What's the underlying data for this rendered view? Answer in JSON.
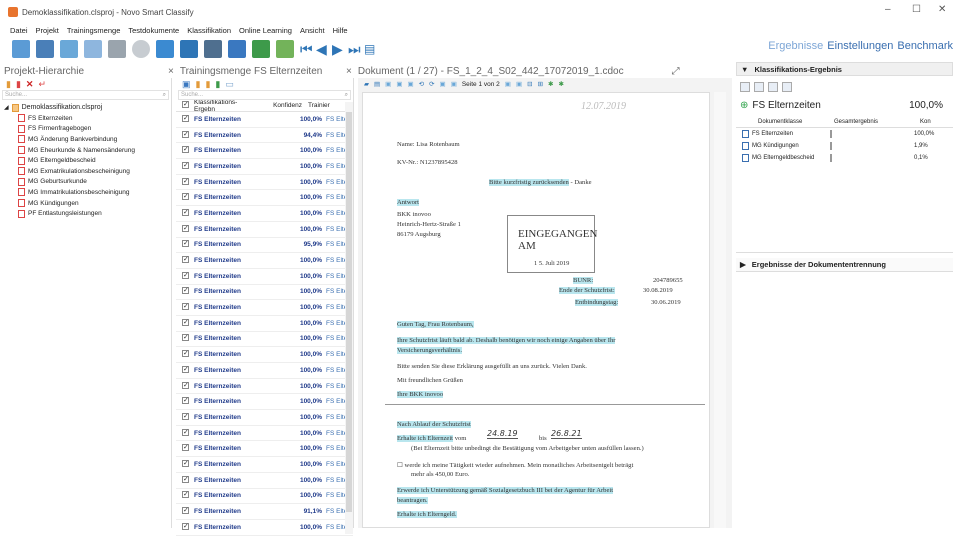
{
  "window": {
    "title": "Demoklassifikation.clsproj - Novo Smart Classify",
    "controls": [
      "–",
      "☐",
      "✕"
    ]
  },
  "menu": [
    "Datei",
    "Projekt",
    "Trainingsmenge",
    "Testdokumente",
    "Klassifikation",
    "Online Learning",
    "Ansicht",
    "Hilfe"
  ],
  "topnav": [
    "Ergebnisse",
    "Einstellungen",
    "Benchmark"
  ],
  "panels": {
    "left_title": "Projekt-Hierarchie",
    "mid_title": "Trainingsmenge FS Elternzeiten",
    "doc_title": "Dokument (1 / 27) - FS_1_2_4_S02_442_17072019_1.cdoc"
  },
  "tree": {
    "search_placeholder": "Suche...",
    "root": "Demoklassifikation.clsproj",
    "items": [
      "FS Elternzeiten",
      "FS Firmenfragebogen",
      "MG Änderung Bankverbindung",
      "MG Eheurkunde & Namensänderung",
      "MG Elterngeldbescheid",
      "MG Exmatrikulationsbescheinigung",
      "MG Geburtsurkunde",
      "MG Immatrikulationsbescheinigung",
      "MG Kündigungen",
      "PF Entlastungsleistungen"
    ]
  },
  "training": {
    "search_placeholder": "Suche...",
    "columns": [
      "Klassifikations-Ergebn",
      "Konfidenz",
      "Trainier"
    ],
    "rows": [
      {
        "label": "FS Elternzeiten",
        "conf": "100,0%",
        "train": "FS Elte"
      },
      {
        "label": "FS Elternzeiten",
        "conf": "94,4%",
        "train": "FS Elte"
      },
      {
        "label": "FS Elternzeiten",
        "conf": "100,0%",
        "train": "FS Elte"
      },
      {
        "label": "FS Elternzeiten",
        "conf": "100,0%",
        "train": "FS Elte"
      },
      {
        "label": "FS Elternzeiten",
        "conf": "100,0%",
        "train": "FS Elte"
      },
      {
        "label": "FS Elternzeiten",
        "conf": "100,0%",
        "train": "FS Elte"
      },
      {
        "label": "FS Elternzeiten",
        "conf": "100,0%",
        "train": "FS Elte"
      },
      {
        "label": "FS Elternzeiten",
        "conf": "100,0%",
        "train": "FS Elte"
      },
      {
        "label": "FS Elternzeiten",
        "conf": "95,9%",
        "train": "FS Elte"
      },
      {
        "label": "FS Elternzeiten",
        "conf": "100,0%",
        "train": "FS Elte"
      },
      {
        "label": "FS Elternzeiten",
        "conf": "100,0%",
        "train": "FS Elte"
      },
      {
        "label": "FS Elternzeiten",
        "conf": "100,0%",
        "train": "FS Elte"
      },
      {
        "label": "FS Elternzeiten",
        "conf": "100,0%",
        "train": "FS Elte"
      },
      {
        "label": "FS Elternzeiten",
        "conf": "100,0%",
        "train": "FS Elte"
      },
      {
        "label": "FS Elternzeiten",
        "conf": "100,0%",
        "train": "FS Elte"
      },
      {
        "label": "FS Elternzeiten",
        "conf": "100,0%",
        "train": "FS Elte"
      },
      {
        "label": "FS Elternzeiten",
        "conf": "100,0%",
        "train": "FS Elte"
      },
      {
        "label": "FS Elternzeiten",
        "conf": "100,0%",
        "train": "FS Elte"
      },
      {
        "label": "FS Elternzeiten",
        "conf": "100,0%",
        "train": "FS Elte"
      },
      {
        "label": "FS Elternzeiten",
        "conf": "100,0%",
        "train": "FS Elte"
      },
      {
        "label": "FS Elternzeiten",
        "conf": "100,0%",
        "train": "FS Elte"
      },
      {
        "label": "FS Elternzeiten",
        "conf": "100,0%",
        "train": "FS Elte"
      },
      {
        "label": "FS Elternzeiten",
        "conf": "100,0%",
        "train": "FS Elte"
      },
      {
        "label": "FS Elternzeiten",
        "conf": "100,0%",
        "train": "FS Elte"
      },
      {
        "label": "FS Elternzeiten",
        "conf": "100,0%",
        "train": "FS Elte"
      },
      {
        "label": "FS Elternzeiten",
        "conf": "91,1%",
        "train": "FS Elte"
      },
      {
        "label": "FS Elternzeiten",
        "conf": "100,0%",
        "train": "FS Elte"
      }
    ]
  },
  "doc": {
    "page_label": "Seite 1 von 2",
    "name": "Name: Lisa Rotenbaum",
    "kv": "KV-Nr.: N1237895428",
    "bitte": "Bitte kurzfristig zurücksenden",
    "danke": "- Danke",
    "antwort": "Antwort",
    "addr1": "BKK inovoo",
    "addr2": "Heinrich-Hertz-Straße 1",
    "addr3": "86179 Augsburg",
    "stamp_line1": "EINGEGANGEN",
    "stamp_line2": "AM",
    "stamp_date": "1 5. Juli 2019",
    "bunr_label": "BUNR:",
    "bunr_value": "204789655",
    "frist_label": "Ende der Schutzfrist:",
    "frist_value": "30.08.2019",
    "entb_label": "Entbindungstag:",
    "entb_value": "30.06.2019",
    "greeting": "Guten Tag, Frau Rotenbaum,",
    "p1a": "Ihre Schutzfrist läuft bald ab. Deshalb benötigen wir noch einige Angaben über Ihr",
    "p1b": "Versicherungsverhältnis.",
    "p2": "Bitte senden Sie diese Erklärung ausgefüllt an uns zurück. Vielen Dank.",
    "p3": "Mit freundlichen Grüßen",
    "p4": "Ihre BKK inovoo",
    "s1": "Nach Ablauf der Schutzfrist",
    "s2a": "Erhalte ich Elternzeit",
    "s2b": "vom",
    "s2c": "bis",
    "s2d": "(Bei Elternzeit bitte unbedingt die Bestätigung vom Arbeitgeber unten ausfüllen lassen.)",
    "s3a": "☐ werde ich meine Tätigkeit wieder aufnehmen. Mein monatliches Arbeitsentgelt beträgt",
    "s3b": "mehr als 450,00 Euro.",
    "s4a": "Erwerde ich Unterstützung gemäß Sozialgesetzbuch III bei der Agentur für Arbeit",
    "s4b": "beantragen.",
    "s5": "Erhalte ich Elterngeld.",
    "hw_from": "24.8.19",
    "hw_to": "26.8.21"
  },
  "results": {
    "header": "Klassifikations-Ergebnis",
    "class": "FS Elternzeiten",
    "class_pct": "100,0%",
    "columns": [
      "Dokumentklasse",
      "Gesamtergebnis",
      "Kon"
    ],
    "rows": [
      {
        "name": "FS Elternzeiten",
        "pct": "100,0%",
        "fill": 1.0
      },
      {
        "name": "MG Kündigungen",
        "pct": "1,9%",
        "fill": 0.019
      },
      {
        "name": "MG Elterngeldbescheid",
        "pct": "0,1%",
        "fill": 0.001
      }
    ],
    "sub_header": "Ergebnisse der Dokumententrennung"
  },
  "colors": {
    "accent": "#3a6fb0",
    "bar": "#2fa34a",
    "highlight": "#b9e6ee"
  }
}
